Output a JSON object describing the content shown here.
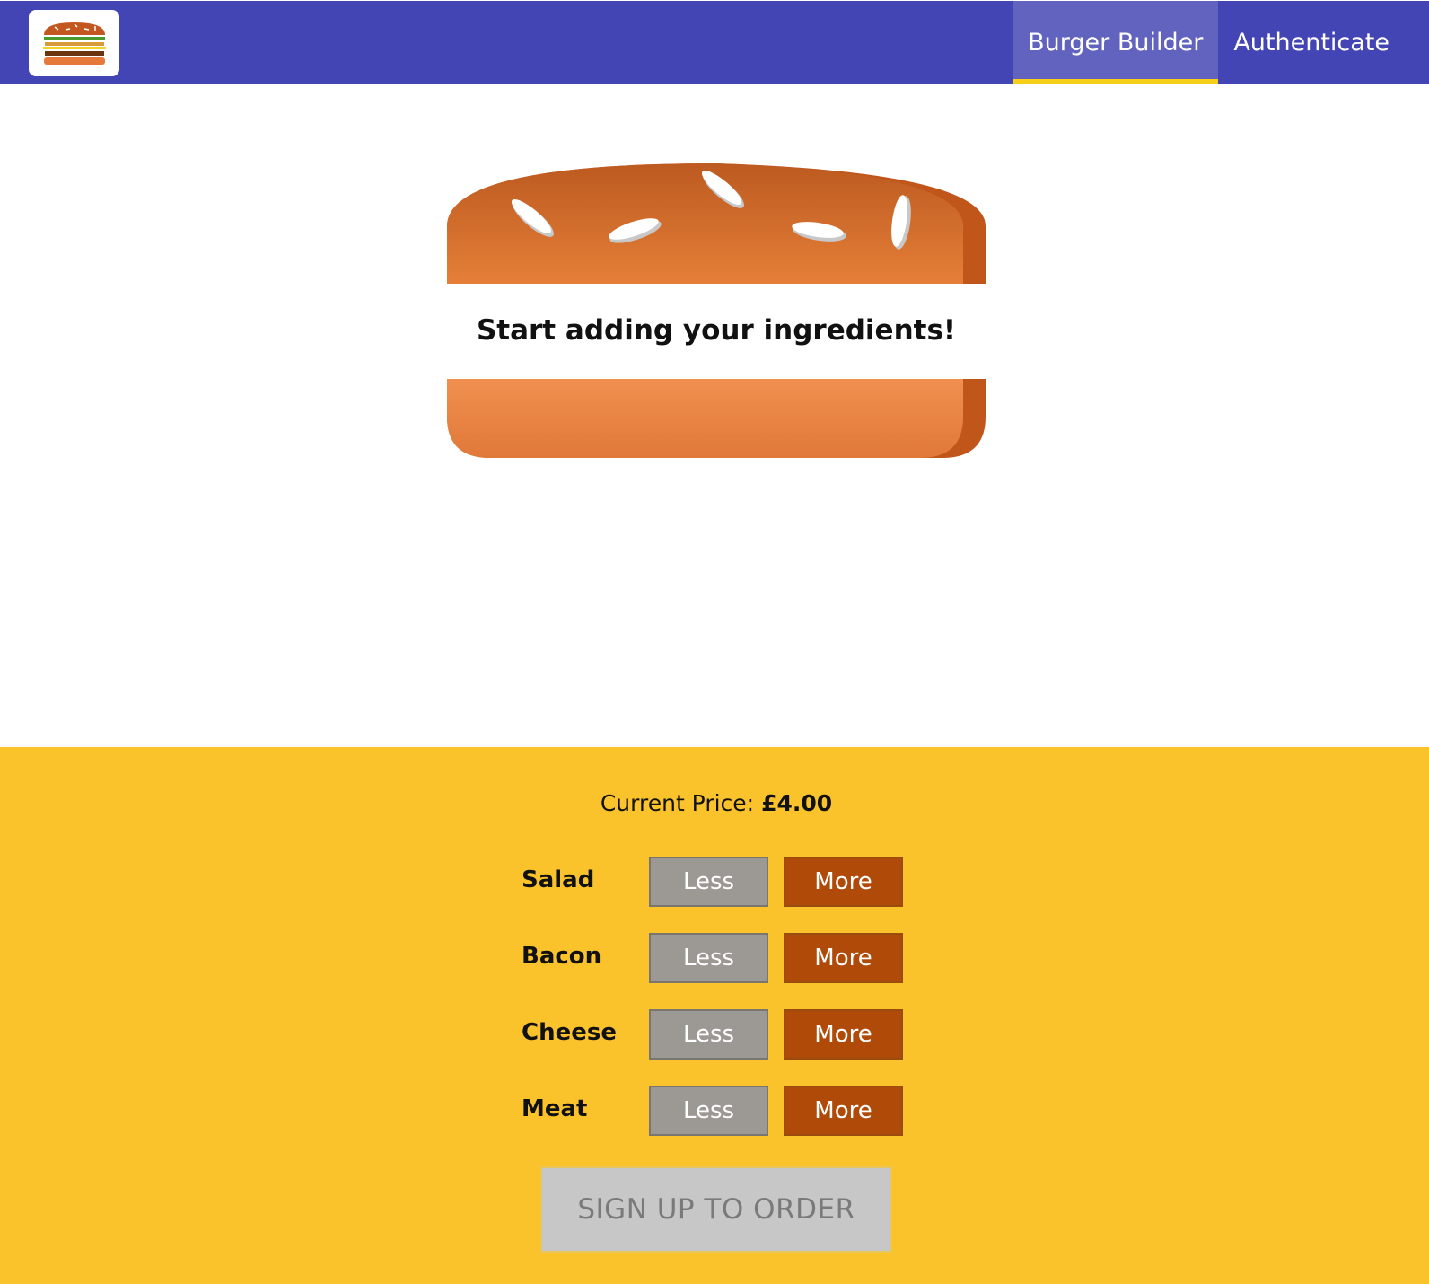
{
  "nav": {
    "items": [
      {
        "label": "Burger Builder",
        "active": true
      },
      {
        "label": "Authenticate",
        "active": false
      }
    ]
  },
  "burger": {
    "empty_message": "Start adding your ingredients!"
  },
  "controls": {
    "price_label": "Current Price:",
    "price_value": "£4.00",
    "ingredients": [
      {
        "label": "Salad",
        "less": "Less",
        "more": "More"
      },
      {
        "label": "Bacon",
        "less": "Less",
        "more": "More"
      },
      {
        "label": "Cheese",
        "less": "Less",
        "more": "More"
      },
      {
        "label": "Meat",
        "less": "Less",
        "more": "More"
      }
    ],
    "order_button": "SIGN UP TO ORDER"
  },
  "colors": {
    "toolbar": "#4345b4",
    "nav_active_bg": "#6163bf",
    "nav_active_underline": "#f7cf19",
    "controls_bg": "#fbc32b",
    "less_button": "#9c9994",
    "more_button": "#b04a08",
    "order_disabled": "#c7c7c7"
  }
}
